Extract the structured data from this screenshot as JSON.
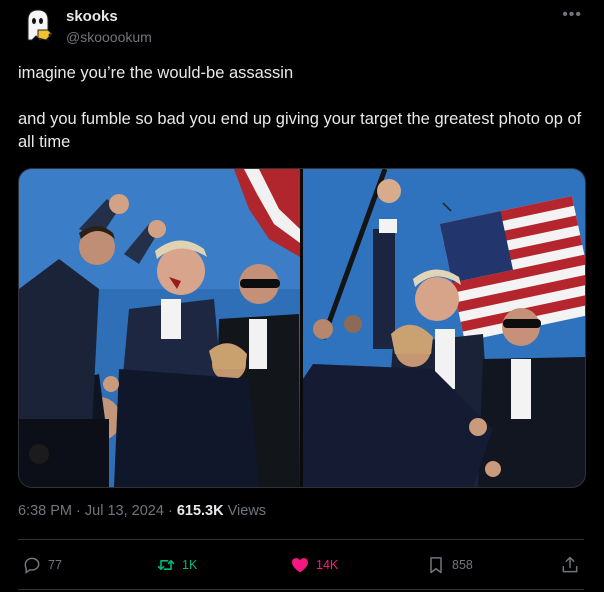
{
  "author": {
    "display_name": "skooks",
    "handle": "@skooookum",
    "avatar_icon": "ghost-icon"
  },
  "post": {
    "lines": [
      "imagine you’re the would-be assassin",
      "and you fumble so bad you end up giving your target the greatest photo op of all time"
    ]
  },
  "media": {
    "photo_left": "photo",
    "photo_right": "photo"
  },
  "meta": {
    "time": "6:38 PM",
    "separator": "·",
    "date": "Jul 13, 2024",
    "views_count": "615.3K",
    "views_label": "Views"
  },
  "actions": {
    "replies": "77",
    "reposts": "1K",
    "likes": "14K",
    "bookmarks": "858"
  },
  "colors": {
    "background": "#000000",
    "text": "#e7e9ea",
    "muted": "#71767b",
    "repost_active": "#00ba7c",
    "like_active": "#f91880",
    "sky": "#2e6fb8"
  }
}
